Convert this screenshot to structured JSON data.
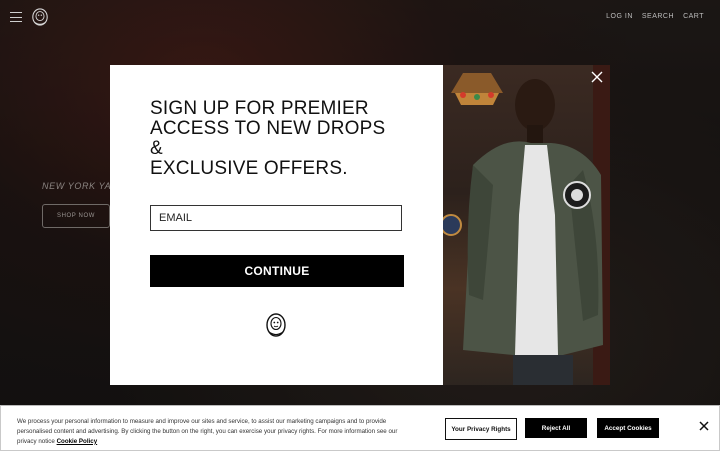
{
  "header": {
    "nav": [
      "LOG IN",
      "SEARCH",
      "CART"
    ]
  },
  "hero": {
    "text": "NEW YORK YANK",
    "shop_button": "SHOP NOW"
  },
  "modal": {
    "headline_lines": [
      "SIGN UP FOR PREMIER",
      "ACCESS TO NEW DROPS &",
      "EXCLUSIVE OFFERS."
    ],
    "email_placeholder": "EMAIL",
    "continue_label": "CONTINUE"
  },
  "cookie_banner": {
    "text": "We process your personal information to measure and improve our sites and service, to assist our marketing campaigns and to provide personalised content and advertising. By clicking the button on the right, you can exercise your privacy rights. For more information see our privacy notice",
    "link": "Cookie Policy",
    "privacy_button": "Your Privacy Rights",
    "reject_button": "Reject All",
    "accept_button": "Accept Cookies"
  },
  "colors": {
    "modal_bg": "#ffffff",
    "button_bg": "#000000",
    "page_bg": "#1c1a19"
  },
  "icons": [
    "menu-icon",
    "astronaut-helmet-logo",
    "close-icon",
    "close-icon"
  ]
}
